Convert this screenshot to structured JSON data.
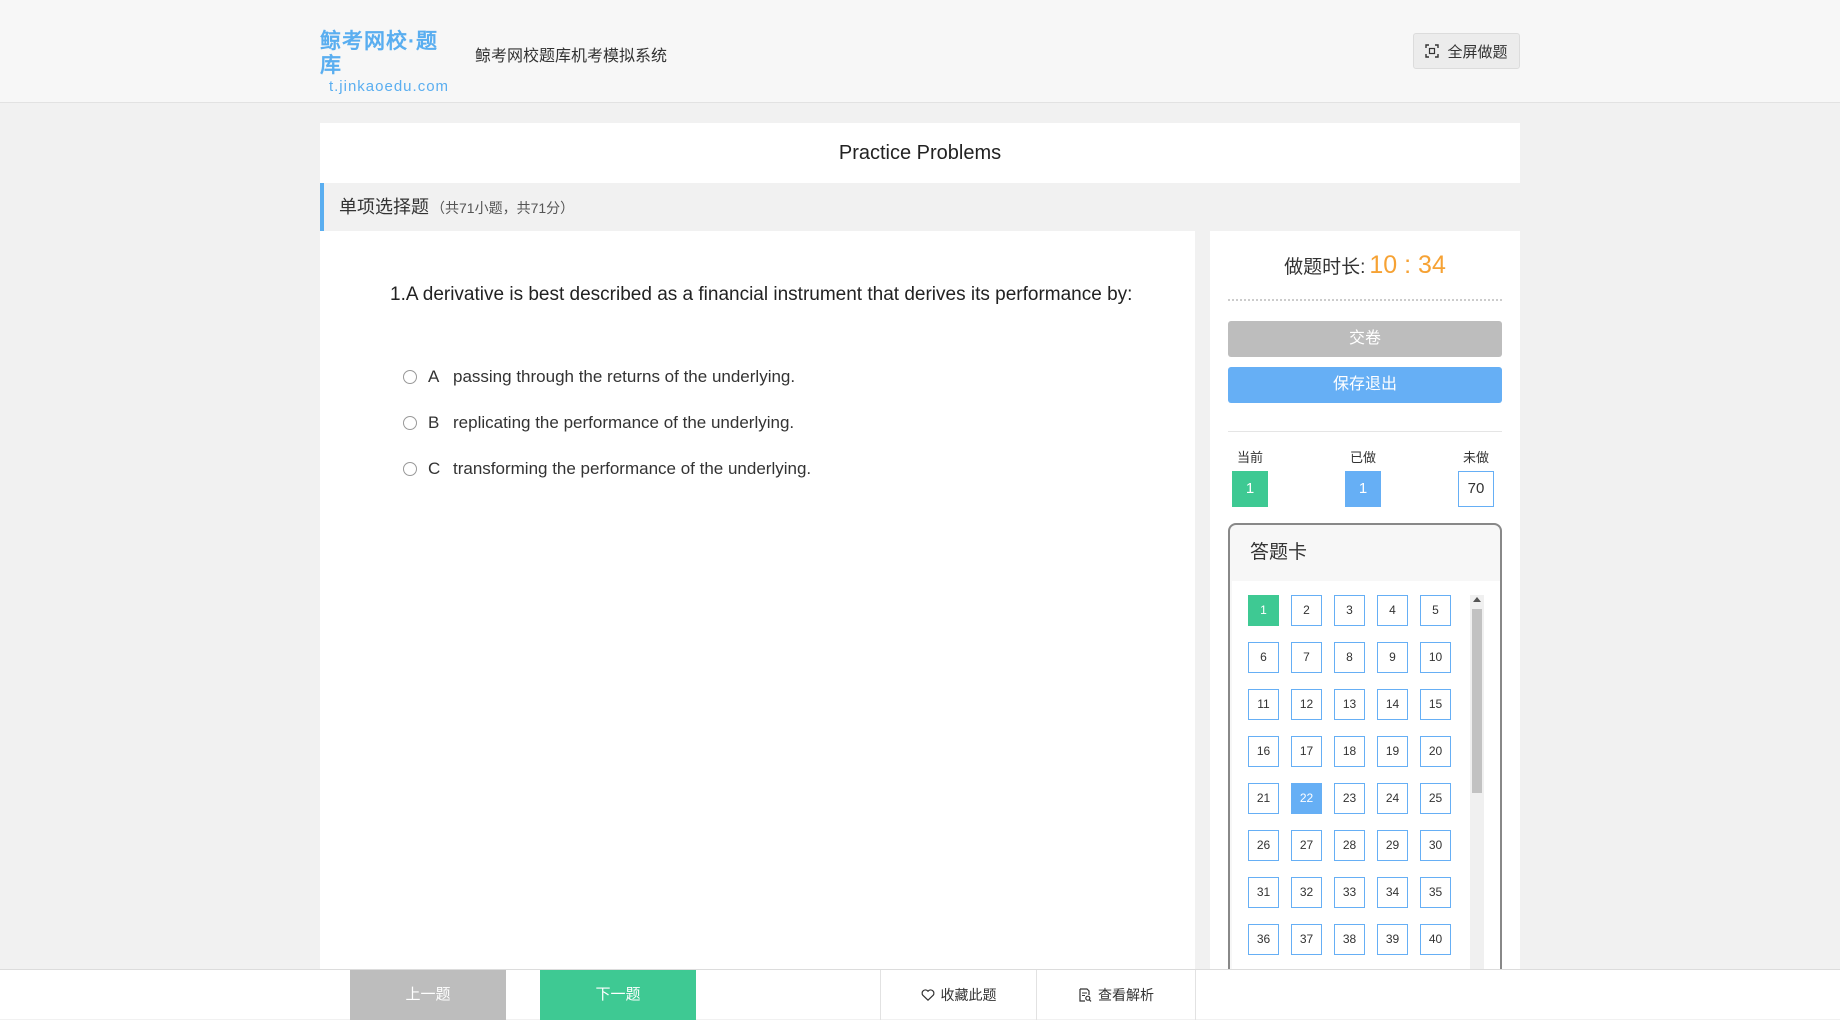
{
  "header": {
    "logo_main": "鲸考网校·题库",
    "logo_sub": "t.jinkaoedu.com",
    "system_title": "鲸考网校题库机考模拟系统",
    "fullscreen_label": "全屏做题"
  },
  "paper": {
    "title": "Practice Problems",
    "section_title": "单项选择题",
    "section_sub": "（共71小题，共71分）"
  },
  "question": {
    "text": "1.A derivative is best described as a financial instrument that derives its performance by:",
    "options": [
      {
        "letter": "A",
        "text": "passing through the returns of the underlying."
      },
      {
        "letter": "B",
        "text": "replicating the performance of the underlying."
      },
      {
        "letter": "C",
        "text": "transforming the performance of the underlying."
      }
    ]
  },
  "side": {
    "timer_label": "做题时长:",
    "timer_value": "10 : 34",
    "submit_label": "交卷",
    "save_label": "保存退出",
    "stats": {
      "current_label": "当前",
      "current_value": "1",
      "done_label": "已做",
      "done_value": "1",
      "todo_label": "未做",
      "todo_value": "70"
    },
    "answer_card_title": "答题卡",
    "current_question": 1,
    "done_questions": [
      22
    ],
    "visible_questions": [
      "1",
      "2",
      "3",
      "4",
      "5",
      "6",
      "7",
      "8",
      "9",
      "10",
      "11",
      "12",
      "13",
      "14",
      "15",
      "16",
      "17",
      "18",
      "19",
      "20",
      "21",
      "22",
      "23",
      "24",
      "25",
      "26",
      "27",
      "28",
      "29",
      "30",
      "31",
      "32",
      "33",
      "34",
      "35",
      "36",
      "37",
      "38",
      "39",
      "40"
    ]
  },
  "bottom": {
    "prev_label": "上一题",
    "next_label": "下一题",
    "favorite_label": "收藏此题",
    "analysis_label": "查看解析"
  },
  "colors": {
    "accent_blue": "#66aff5",
    "accent_green": "#3ec993",
    "timer_orange": "#f6a234",
    "disabled_gray": "#bdbdbd"
  }
}
